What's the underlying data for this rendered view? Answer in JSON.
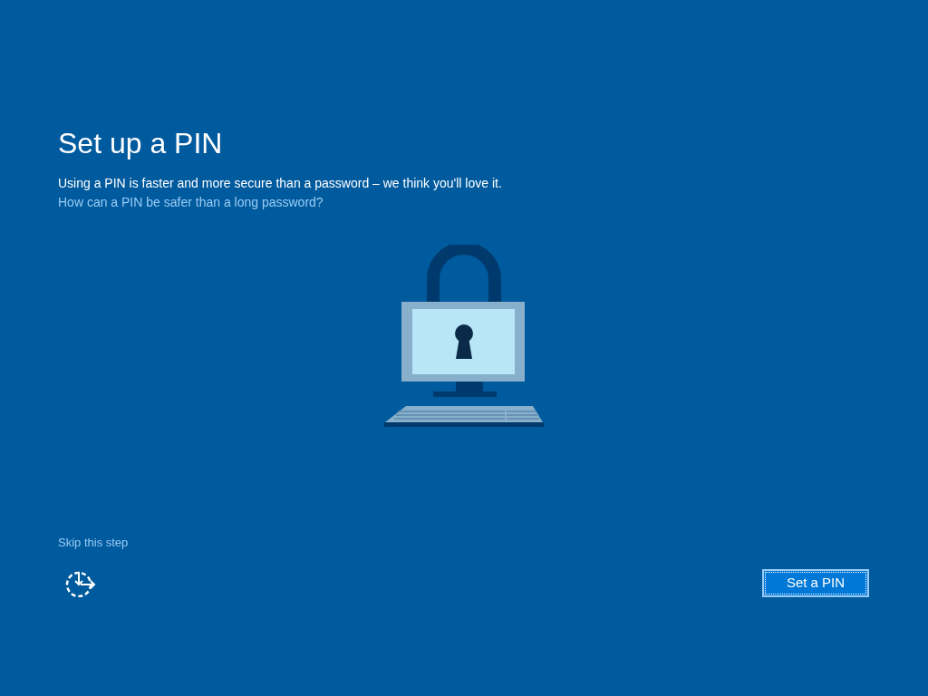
{
  "title": "Set up a PIN",
  "description": "Using a PIN is faster and more secure than a password – we think you'll love it.",
  "info_link": "How can a PIN be safer than a long password?",
  "skip_link": "Skip this step",
  "primary_button": {
    "label": "Set a PIN",
    "focused": true
  }
}
